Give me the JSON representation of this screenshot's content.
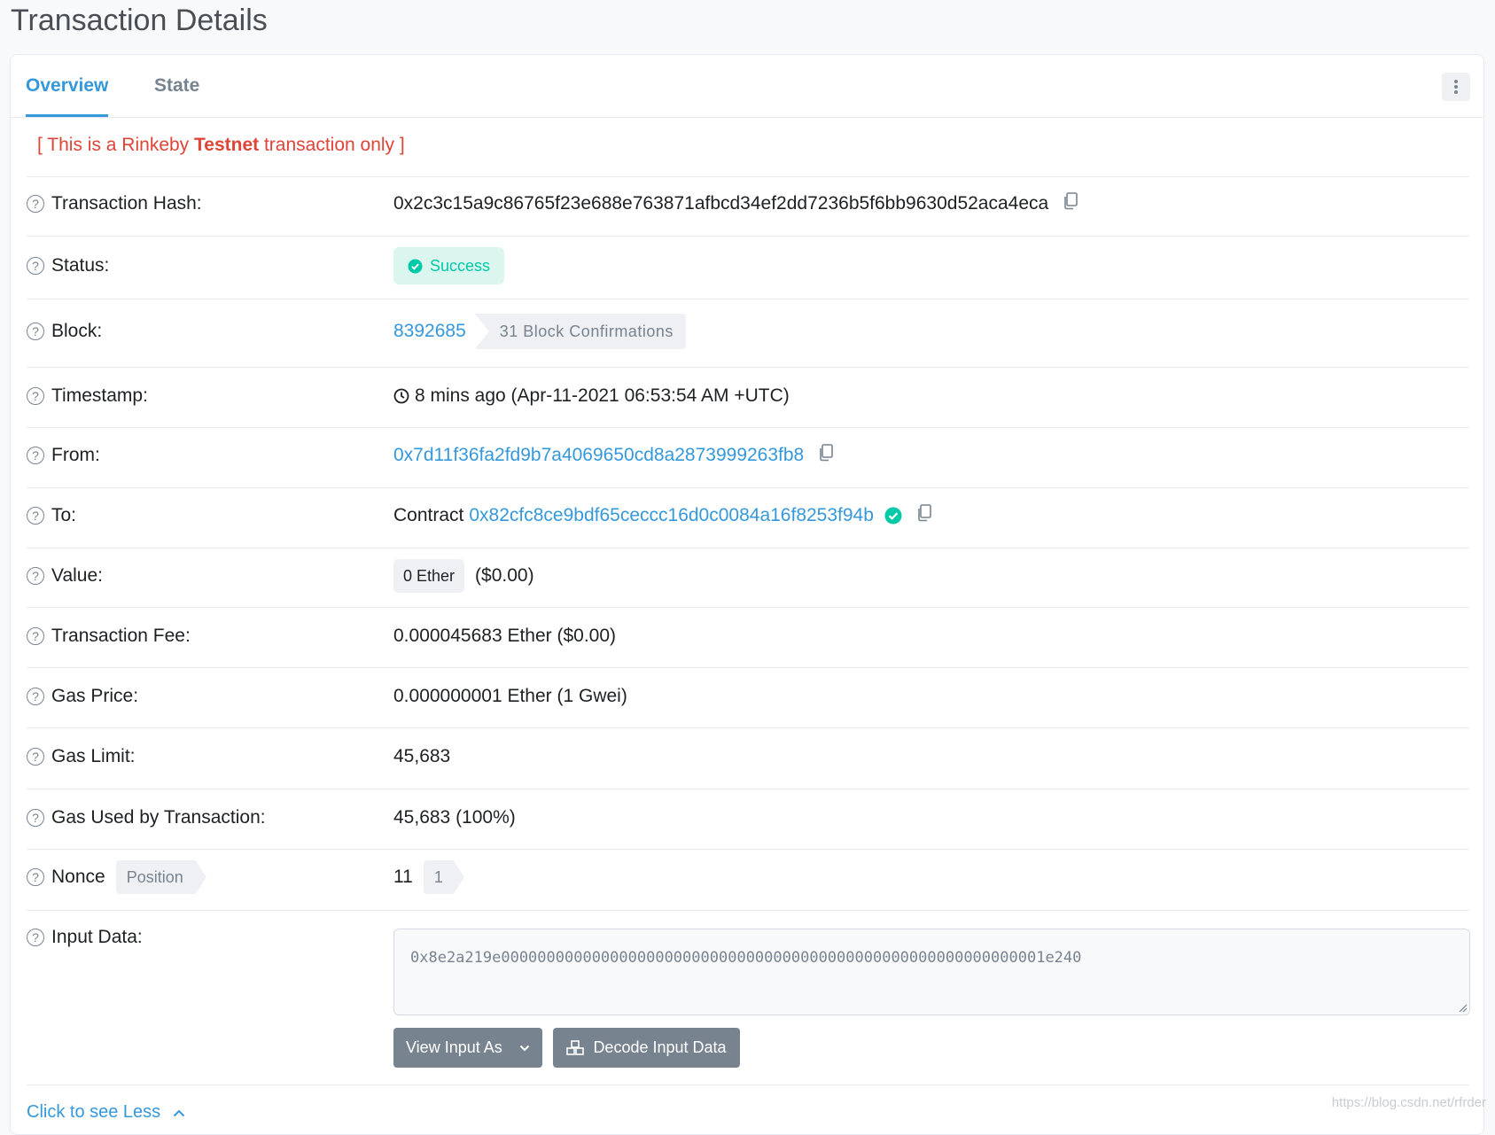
{
  "page": {
    "title": "Transaction Details"
  },
  "tabs": [
    {
      "label": "Overview",
      "active": true
    },
    {
      "label": "State",
      "active": false
    }
  ],
  "notice": {
    "prefix": "[ This is a Rinkeby ",
    "bold": "Testnet",
    "suffix": " transaction only ]"
  },
  "rows": {
    "hash": {
      "label": "Transaction Hash:",
      "value": "0x2c3c15a9c86765f23e688e763871afbcd34ef2dd7236b5f6bb9630d52aca4eca"
    },
    "status": {
      "label": "Status:",
      "value": "Success"
    },
    "block": {
      "label": "Block:",
      "number": "8392685",
      "confirmations": "31 Block Confirmations"
    },
    "timestamp": {
      "label": "Timestamp:",
      "value": "8 mins ago (Apr-11-2021 06:53:54 AM +UTC)"
    },
    "from": {
      "label": "From:",
      "value": "0x7d11f36fa2fd9b7a4069650cd8a2873999263fb8"
    },
    "to": {
      "label": "To:",
      "prefix": "Contract",
      "value": "0x82cfc8ce9bdf65ceccc16d0c0084a16f8253f94b"
    },
    "value": {
      "label": "Value:",
      "amount": "0 Ether",
      "usd": "($0.00)"
    },
    "fee": {
      "label": "Transaction Fee:",
      "value": "0.000045683 Ether ($0.00)"
    },
    "gas_price": {
      "label": "Gas Price:",
      "value": "0.000000001 Ether (1 Gwei)"
    },
    "gas_limit": {
      "label": "Gas Limit:",
      "value": "45,683"
    },
    "gas_used": {
      "label": "Gas Used by Transaction:",
      "value": "45,683 (100%)"
    },
    "nonce": {
      "label": "Nonce",
      "position_label": "Position",
      "value": "11",
      "position": "1"
    },
    "input": {
      "label": "Input Data:",
      "value": "0x8e2a219e000000000000000000000000000000000000000000000000000000000001e240"
    }
  },
  "buttons": {
    "view_input": "View Input As",
    "decode": "Decode Input Data"
  },
  "footer": {
    "see_less": "Click to see Less",
    "watermark": "https://blog.csdn.net/rfrder"
  },
  "colors": {
    "accent": "#3498db",
    "success": "#00c9a7",
    "danger": "#de4437",
    "muted": "#77838f"
  }
}
